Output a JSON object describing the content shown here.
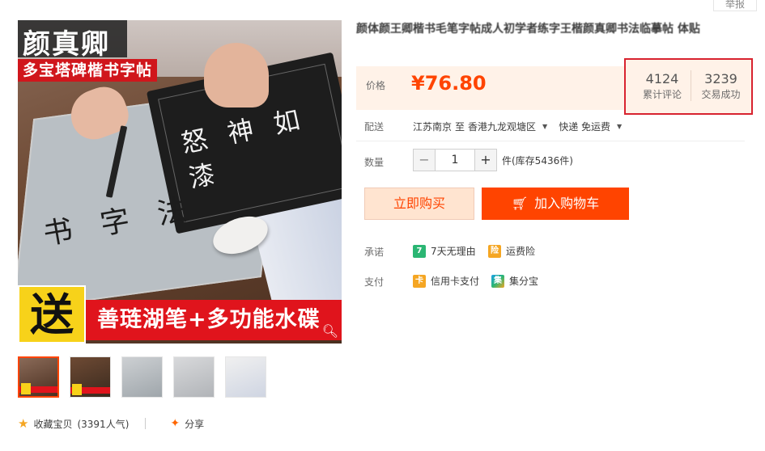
{
  "header": {
    "report_label": "举报"
  },
  "gallery": {
    "brand_text": "颜真卿",
    "subtitle_text": "多宝塔碑楷书字帖",
    "promo_song": "送",
    "promo_text": "善琏湖笔+多功能水碟",
    "book_chars": "怒 神 如 漆",
    "paper_chars": "书 字 法",
    "thumbnails": [
      "thumb-1",
      "thumb-2",
      "thumb-3",
      "thumb-4",
      "thumb-5"
    ]
  },
  "actions_bottom": {
    "favorite_label": "收藏宝贝",
    "favorite_count": "(3391人气)",
    "share_label": "分享"
  },
  "product": {
    "title": "颜体颜王卿楷书毛笔字帖成人初学者练字王楷颜真卿书法临摹帖 体贴",
    "price_label": "价格",
    "price": "¥76.80",
    "stats": {
      "reviews_count": "4124",
      "reviews_label": "累计评论",
      "sales_count": "3239",
      "sales_label": "交易成功"
    },
    "shipping": {
      "label": "配送",
      "from": "江苏南京",
      "to_word": "至",
      "destination": "香港九龙观塘区",
      "method": "快递 免运费"
    },
    "quantity": {
      "label": "数量",
      "minus": "−",
      "value": "1",
      "plus": "+",
      "stock_text": "件(库存5436件)"
    },
    "buy_now_label": "立即购买",
    "add_cart_label": "加入购物车",
    "promise": {
      "label": "承诺",
      "items": [
        {
          "icon_text": "7",
          "text": "7天无理由"
        },
        {
          "icon_text": "险",
          "text": "运费险"
        }
      ]
    },
    "payment": {
      "label": "支付",
      "items": [
        {
          "icon_text": "卡",
          "text": "信用卡支付"
        },
        {
          "icon_text": "集",
          "text": "集分宝"
        }
      ]
    }
  },
  "colors": {
    "accent": "#ff4400",
    "price": "#ff4400",
    "highlight_border": "#d8232f",
    "panel_bg": "#fff2e8"
  }
}
